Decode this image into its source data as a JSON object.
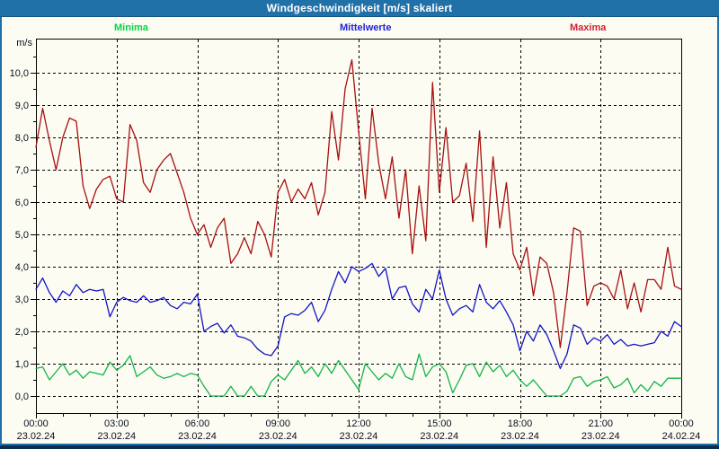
{
  "window": {
    "title": "Windgeschwindigkeit [m/s] skaliert"
  },
  "legend": {
    "minima": "Minima",
    "mittelwerte": "Mittelwerte",
    "maxima": "Maxima"
  },
  "colors": {
    "titlebar_bg": "#2171A9",
    "window_border": "#1F6FAC",
    "bottom_strip": "#0D2C50",
    "legend_minima": "#00D44A",
    "legend_mittelwerte": "#2323DC",
    "legend_maxima": "#D02038",
    "line_minima": "#12B447",
    "line_mittelwerte": "#1216C8",
    "line_maxima": "#A81010",
    "axis_text": "#0A1020",
    "grid": "#000000",
    "plot_bg": "#FCFCF2"
  },
  "chart_data": {
    "type": "line",
    "title": "Windgeschwindigkeit [m/s] skaliert",
    "y_unit": "m/s",
    "ylim": [
      0,
      11.05
    ],
    "y_tick_step": 1.0,
    "y_tick_labels": [
      "0,0",
      "1,0",
      "2,0",
      "3,0",
      "4,0",
      "5,0",
      "6,0",
      "7,0",
      "8,0",
      "9,0",
      "10,0"
    ],
    "grid": true,
    "legend_position": "top",
    "x_hours_span": 24,
    "x_step_hours": 0.25,
    "x_ticks": [
      {
        "hour": 0,
        "time": "00:00",
        "date": "23.02.24"
      },
      {
        "hour": 3,
        "time": "03:00",
        "date": "23.02.24"
      },
      {
        "hour": 6,
        "time": "06:00",
        "date": "23.02.24"
      },
      {
        "hour": 9,
        "time": "09:00",
        "date": "23.02.24"
      },
      {
        "hour": 12,
        "time": "12:00",
        "date": "23.02.24"
      },
      {
        "hour": 15,
        "time": "15:00",
        "date": "23.02.24"
      },
      {
        "hour": 18,
        "time": "18:00",
        "date": "23.02.24"
      },
      {
        "hour": 21,
        "time": "21:00",
        "date": "23.02.24"
      },
      {
        "hour": 24,
        "time": "00:00",
        "date": "24.02.24"
      }
    ],
    "x_minor_tick_hours": 1,
    "series": [
      {
        "name": "Minima",
        "color_key": "line_minima",
        "values": [
          0.85,
          0.9,
          0.5,
          0.75,
          1.0,
          0.65,
          0.8,
          0.55,
          0.75,
          0.7,
          0.65,
          1.05,
          0.8,
          0.95,
          1.25,
          0.6,
          0.75,
          0.9,
          0.65,
          0.55,
          0.6,
          0.7,
          0.6,
          0.7,
          0.65,
          0.3,
          0.0,
          0.0,
          0.0,
          0.3,
          0.0,
          0.0,
          0.3,
          0.0,
          0.0,
          0.45,
          0.65,
          0.5,
          0.8,
          1.1,
          0.7,
          0.9,
          0.6,
          1.0,
          0.7,
          1.1,
          0.8,
          0.5,
          0.2,
          1.0,
          0.75,
          0.5,
          0.7,
          0.55,
          1.0,
          0.6,
          0.5,
          1.3,
          0.6,
          0.9,
          1.0,
          0.75,
          0.1,
          0.5,
          0.95,
          1.0,
          0.6,
          1.05,
          0.75,
          0.95,
          0.6,
          0.8,
          0.5,
          0.3,
          0.5,
          0.25,
          0.0,
          0.0,
          0.0,
          0.15,
          0.55,
          0.6,
          0.3,
          0.45,
          0.5,
          0.6,
          0.25,
          0.35,
          0.55,
          0.1,
          0.35,
          0.15,
          0.45,
          0.3,
          0.55,
          0.55,
          0.55
        ]
      },
      {
        "name": "Mittelwerte",
        "color_key": "line_mittelwerte",
        "values": [
          3.3,
          3.65,
          3.2,
          2.9,
          3.25,
          3.1,
          3.45,
          3.2,
          3.3,
          3.25,
          3.3,
          2.45,
          2.9,
          3.05,
          2.95,
          2.9,
          3.1,
          2.9,
          2.95,
          3.05,
          2.8,
          2.7,
          2.9,
          2.85,
          3.15,
          2.0,
          2.15,
          2.25,
          1.95,
          2.2,
          1.85,
          1.8,
          1.7,
          1.45,
          1.3,
          1.25,
          1.55,
          2.45,
          2.55,
          2.5,
          2.65,
          2.9,
          2.3,
          2.65,
          3.3,
          3.85,
          3.5,
          4.0,
          3.85,
          3.95,
          4.1,
          3.7,
          3.95,
          3.0,
          3.35,
          3.4,
          2.85,
          2.6,
          3.3,
          3.0,
          3.9,
          3.0,
          2.5,
          2.7,
          2.8,
          2.6,
          3.45,
          2.9,
          2.7,
          2.95,
          2.6,
          2.2,
          1.4,
          2.0,
          1.7,
          2.2,
          1.9,
          1.4,
          0.85,
          1.3,
          2.2,
          2.1,
          1.6,
          1.8,
          1.7,
          1.9,
          1.6,
          1.75,
          1.55,
          1.6,
          1.55,
          1.6,
          1.65,
          2.0,
          1.85,
          2.3,
          2.15
        ]
      },
      {
        "name": "Maxima",
        "color_key": "line_maxima",
        "values": [
          7.7,
          8.9,
          7.9,
          7.0,
          8.0,
          8.6,
          8.5,
          6.5,
          5.8,
          6.4,
          6.7,
          6.8,
          6.1,
          6.0,
          8.4,
          7.9,
          6.6,
          6.3,
          7.0,
          7.3,
          7.5,
          6.9,
          6.3,
          5.5,
          5.0,
          5.3,
          4.6,
          5.2,
          5.5,
          4.1,
          4.4,
          4.9,
          4.4,
          5.4,
          5.0,
          4.3,
          6.3,
          6.7,
          6.0,
          6.4,
          6.1,
          6.6,
          5.6,
          6.3,
          8.8,
          7.3,
          9.5,
          10.4,
          8.2,
          6.1,
          8.9,
          7.2,
          6.1,
          7.4,
          5.5,
          7.0,
          4.4,
          6.5,
          4.8,
          9.7,
          6.3,
          8.3,
          6.0,
          6.2,
          7.2,
          5.4,
          8.2,
          4.6,
          7.4,
          5.2,
          6.6,
          4.4,
          3.9,
          4.6,
          3.1,
          4.3,
          4.1,
          3.2,
          1.5,
          3.2,
          5.2,
          5.1,
          2.8,
          3.4,
          3.5,
          3.4,
          3.0,
          3.9,
          2.7,
          3.5,
          2.6,
          3.6,
          3.6,
          3.3,
          4.6,
          3.4,
          3.3
        ]
      }
    ]
  }
}
